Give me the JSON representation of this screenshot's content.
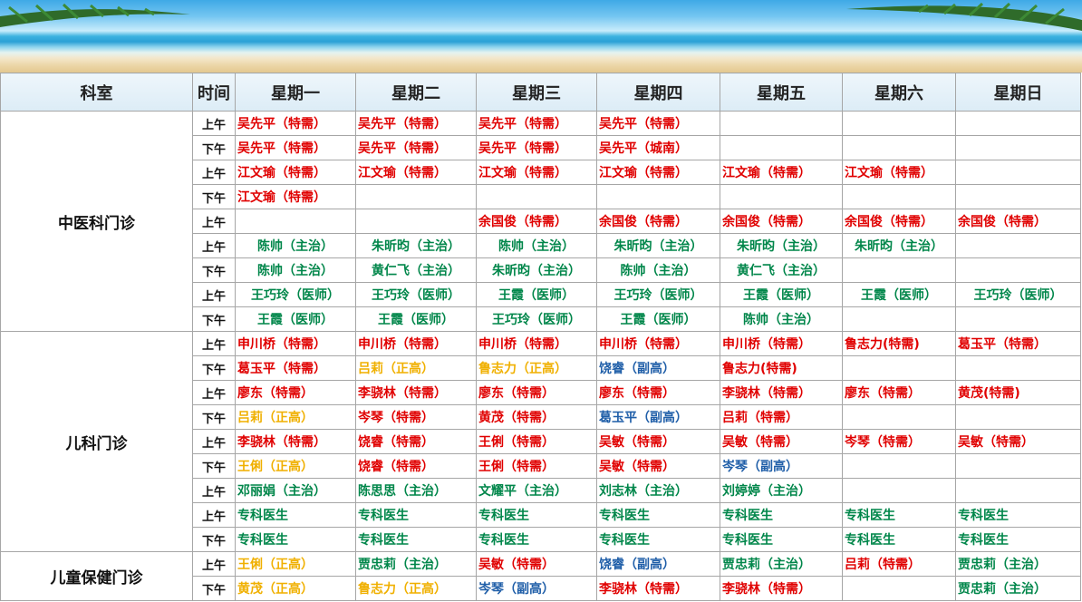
{
  "colors": {
    "red": "#e00000",
    "green": "#00864a",
    "gold": "#f0b000",
    "blue": "#1f5ea8"
  },
  "header": {
    "dept": "科室",
    "time": "时间",
    "days": [
      "星期一",
      "星期二",
      "星期三",
      "星期四",
      "星期五",
      "星期六",
      "星期日"
    ]
  },
  "departments": [
    {
      "name": "中医科门诊",
      "rows": [
        {
          "time": "上午",
          "cells": [
            {
              "t": "吴先平（特需）",
              "c": "red"
            },
            {
              "t": "吴先平（特需）",
              "c": "red"
            },
            {
              "t": "吴先平（特需）",
              "c": "red"
            },
            {
              "t": "吴先平（特需）",
              "c": "red"
            },
            {
              "t": "",
              "c": ""
            },
            {
              "t": "",
              "c": ""
            },
            {
              "t": "",
              "c": ""
            }
          ]
        },
        {
          "time": "下午",
          "cells": [
            {
              "t": "吴先平（特需）",
              "c": "red"
            },
            {
              "t": "吴先平（特需）",
              "c": "red"
            },
            {
              "t": "吴先平（特需）",
              "c": "red"
            },
            {
              "t": "吴先平（城南）",
              "c": "red"
            },
            {
              "t": "",
              "c": ""
            },
            {
              "t": "",
              "c": ""
            },
            {
              "t": "",
              "c": ""
            }
          ]
        },
        {
          "time": "上午",
          "cells": [
            {
              "t": "江文瑜（特需）",
              "c": "red"
            },
            {
              "t": "江文瑜（特需）",
              "c": "red"
            },
            {
              "t": "江文瑜（特需）",
              "c": "red"
            },
            {
              "t": "江文瑜（特需）",
              "c": "red"
            },
            {
              "t": "江文瑜（特需）",
              "c": "red"
            },
            {
              "t": "江文瑜（特需）",
              "c": "red"
            },
            {
              "t": "",
              "c": ""
            }
          ]
        },
        {
          "time": "下午",
          "cells": [
            {
              "t": "江文瑜（特需）",
              "c": "red"
            },
            {
              "t": "",
              "c": ""
            },
            {
              "t": "",
              "c": ""
            },
            {
              "t": "",
              "c": ""
            },
            {
              "t": "",
              "c": ""
            },
            {
              "t": "",
              "c": ""
            },
            {
              "t": "",
              "c": ""
            }
          ]
        },
        {
          "time": "上午",
          "cells": [
            {
              "t": "",
              "c": ""
            },
            {
              "t": "",
              "c": ""
            },
            {
              "t": "余国俊（特需）",
              "c": "red"
            },
            {
              "t": "余国俊（特需）",
              "c": "red"
            },
            {
              "t": "余国俊（特需）",
              "c": "red"
            },
            {
              "t": "余国俊（特需）",
              "c": "red"
            },
            {
              "t": "余国俊（特需）",
              "c": "red"
            }
          ]
        },
        {
          "time": "上午",
          "cells": [
            {
              "t": "陈帅（主治）",
              "c": "green",
              "a": "c"
            },
            {
              "t": "朱昕昀（主治）",
              "c": "green",
              "a": "c"
            },
            {
              "t": "陈帅（主治）",
              "c": "green",
              "a": "c"
            },
            {
              "t": "朱昕昀（主治）",
              "c": "green",
              "a": "c"
            },
            {
              "t": "朱昕昀（主治）",
              "c": "green",
              "a": "c"
            },
            {
              "t": "朱昕昀（主治）",
              "c": "green",
              "a": "c"
            },
            {
              "t": "",
              "c": ""
            }
          ]
        },
        {
          "time": "下午",
          "cells": [
            {
              "t": "陈帅（主治）",
              "c": "green",
              "a": "c"
            },
            {
              "t": "黄仁飞（主治）",
              "c": "green",
              "a": "c"
            },
            {
              "t": "朱昕昀（主治）",
              "c": "green",
              "a": "c"
            },
            {
              "t": "陈帅（主治）",
              "c": "green",
              "a": "c"
            },
            {
              "t": "黄仁飞（主治）",
              "c": "green",
              "a": "c"
            },
            {
              "t": "",
              "c": ""
            },
            {
              "t": "",
              "c": ""
            }
          ]
        },
        {
          "time": "上午",
          "cells": [
            {
              "t": "王巧玲（医师）",
              "c": "green",
              "a": "c"
            },
            {
              "t": "王巧玲（医师）",
              "c": "green",
              "a": "c"
            },
            {
              "t": "王霞（医师）",
              "c": "green",
              "a": "c"
            },
            {
              "t": "王巧玲（医师）",
              "c": "green",
              "a": "c"
            },
            {
              "t": "王霞（医师）",
              "c": "green",
              "a": "c"
            },
            {
              "t": "王霞（医师）",
              "c": "green",
              "a": "c"
            },
            {
              "t": "王巧玲（医师）",
              "c": "green",
              "a": "c"
            }
          ]
        },
        {
          "time": "下午",
          "cells": [
            {
              "t": "王霞（医师）",
              "c": "green",
              "a": "c"
            },
            {
              "t": "王霞（医师）",
              "c": "green",
              "a": "c"
            },
            {
              "t": "王巧玲（医师）",
              "c": "green",
              "a": "c"
            },
            {
              "t": "王霞（医师）",
              "c": "green",
              "a": "c"
            },
            {
              "t": "陈帅（主治）",
              "c": "green",
              "a": "c"
            },
            {
              "t": "",
              "c": ""
            },
            {
              "t": "",
              "c": ""
            }
          ]
        }
      ]
    },
    {
      "name": "儿科门诊",
      "rows": [
        {
          "time": "上午",
          "cells": [
            {
              "t": "申川桥（特需）",
              "c": "red"
            },
            {
              "t": "申川桥（特需）",
              "c": "red"
            },
            {
              "t": "申川桥（特需）",
              "c": "red"
            },
            {
              "t": "申川桥（特需）",
              "c": "red"
            },
            {
              "t": "申川桥（特需）",
              "c": "red"
            },
            {
              "t": "鲁志力(特需)",
              "c": "red"
            },
            {
              "t": "葛玉平（特需）",
              "c": "red"
            }
          ]
        },
        {
          "time": "下午",
          "cells": [
            {
              "t": "葛玉平（特需）",
              "c": "red"
            },
            {
              "t": "吕莉（正高）",
              "c": "gold"
            },
            {
              "t": "鲁志力（正高）",
              "c": "gold"
            },
            {
              "t": "饶睿（副高）",
              "c": "blue"
            },
            {
              "t": "鲁志力(特需)",
              "c": "red"
            },
            {
              "t": "",
              "c": ""
            },
            {
              "t": "",
              "c": ""
            }
          ]
        },
        {
          "time": "上午",
          "cells": [
            {
              "t": "廖东（特需）",
              "c": "red"
            },
            {
              "t": "李骁林（特需）",
              "c": "red"
            },
            {
              "t": "廖东（特需）",
              "c": "red"
            },
            {
              "t": "廖东（特需）",
              "c": "red"
            },
            {
              "t": "李骁林（特需）",
              "c": "red"
            },
            {
              "t": "廖东（特需）",
              "c": "red"
            },
            {
              "t": "黄茂(特需)",
              "c": "red"
            }
          ]
        },
        {
          "time": "下午",
          "cells": [
            {
              "t": "吕莉（正高）",
              "c": "gold"
            },
            {
              "t": "岑琴（特需）",
              "c": "red"
            },
            {
              "t": "黄茂（特需）",
              "c": "red"
            },
            {
              "t": "葛玉平（副高）",
              "c": "blue"
            },
            {
              "t": "吕莉（特需）",
              "c": "red"
            },
            {
              "t": "",
              "c": ""
            },
            {
              "t": "",
              "c": ""
            }
          ]
        },
        {
          "time": "上午",
          "cells": [
            {
              "t": "李骁林（特需）",
              "c": "red"
            },
            {
              "t": "饶睿（特需）",
              "c": "red"
            },
            {
              "t": "王俐（特需）",
              "c": "red"
            },
            {
              "t": "吴敏（特需）",
              "c": "red"
            },
            {
              "t": "吴敏（特需）",
              "c": "red"
            },
            {
              "t": "岑琴（特需）",
              "c": "red"
            },
            {
              "t": "吴敏（特需）",
              "c": "red"
            }
          ]
        },
        {
          "time": "下午",
          "cells": [
            {
              "t": "王俐（正高）",
              "c": "gold"
            },
            {
              "t": "饶睿（特需）",
              "c": "red"
            },
            {
              "t": "王俐（特需）",
              "c": "red"
            },
            {
              "t": "吴敏（特需）",
              "c": "red"
            },
            {
              "t": "岑琴（副高）",
              "c": "blue"
            },
            {
              "t": "",
              "c": ""
            },
            {
              "t": "",
              "c": ""
            }
          ]
        },
        {
          "time": "上午",
          "cells": [
            {
              "t": "邓丽娟（主治）",
              "c": "green"
            },
            {
              "t": "陈思思（主治）",
              "c": "green"
            },
            {
              "t": "文耀平（主治）",
              "c": "green"
            },
            {
              "t": "刘志林（主治）",
              "c": "green"
            },
            {
              "t": "刘婷婷（主治）",
              "c": "green"
            },
            {
              "t": "",
              "c": ""
            },
            {
              "t": "",
              "c": ""
            }
          ]
        },
        {
          "time": "上午",
          "cells": [
            {
              "t": "专科医生",
              "c": "green"
            },
            {
              "t": "专科医生",
              "c": "green"
            },
            {
              "t": "专科医生",
              "c": "green"
            },
            {
              "t": "专科医生",
              "c": "green"
            },
            {
              "t": "专科医生",
              "c": "green"
            },
            {
              "t": "专科医生",
              "c": "green"
            },
            {
              "t": "专科医生",
              "c": "green"
            }
          ]
        },
        {
          "time": "下午",
          "cells": [
            {
              "t": "专科医生",
              "c": "green"
            },
            {
              "t": "专科医生",
              "c": "green"
            },
            {
              "t": "专科医生",
              "c": "green"
            },
            {
              "t": "专科医生",
              "c": "green"
            },
            {
              "t": "专科医生",
              "c": "green"
            },
            {
              "t": "专科医生",
              "c": "green"
            },
            {
              "t": "专科医生",
              "c": "green"
            }
          ]
        }
      ]
    },
    {
      "name": "儿童保健门诊",
      "rows": [
        {
          "time": "上午",
          "cells": [
            {
              "t": "王俐（正高）",
              "c": "gold"
            },
            {
              "t": "贾忠莉（主治）",
              "c": "green"
            },
            {
              "t": "吴敏（特需）",
              "c": "red"
            },
            {
              "t": "饶睿（副高）",
              "c": "blue"
            },
            {
              "t": "贾忠莉（主治）",
              "c": "green"
            },
            {
              "t": "吕莉（特需）",
              "c": "red"
            },
            {
              "t": "贾忠莉（主治）",
              "c": "green"
            }
          ]
        },
        {
          "time": "下午",
          "cells": [
            {
              "t": "黄茂（正高）",
              "c": "gold"
            },
            {
              "t": "鲁志力（正高）",
              "c": "gold"
            },
            {
              "t": "岑琴（副高）",
              "c": "blue"
            },
            {
              "t": "李骁林（特需）",
              "c": "red"
            },
            {
              "t": "李骁林（特需）",
              "c": "red"
            },
            {
              "t": "",
              "c": ""
            },
            {
              "t": "贾忠莉（主治）",
              "c": "green"
            }
          ]
        }
      ]
    }
  ]
}
